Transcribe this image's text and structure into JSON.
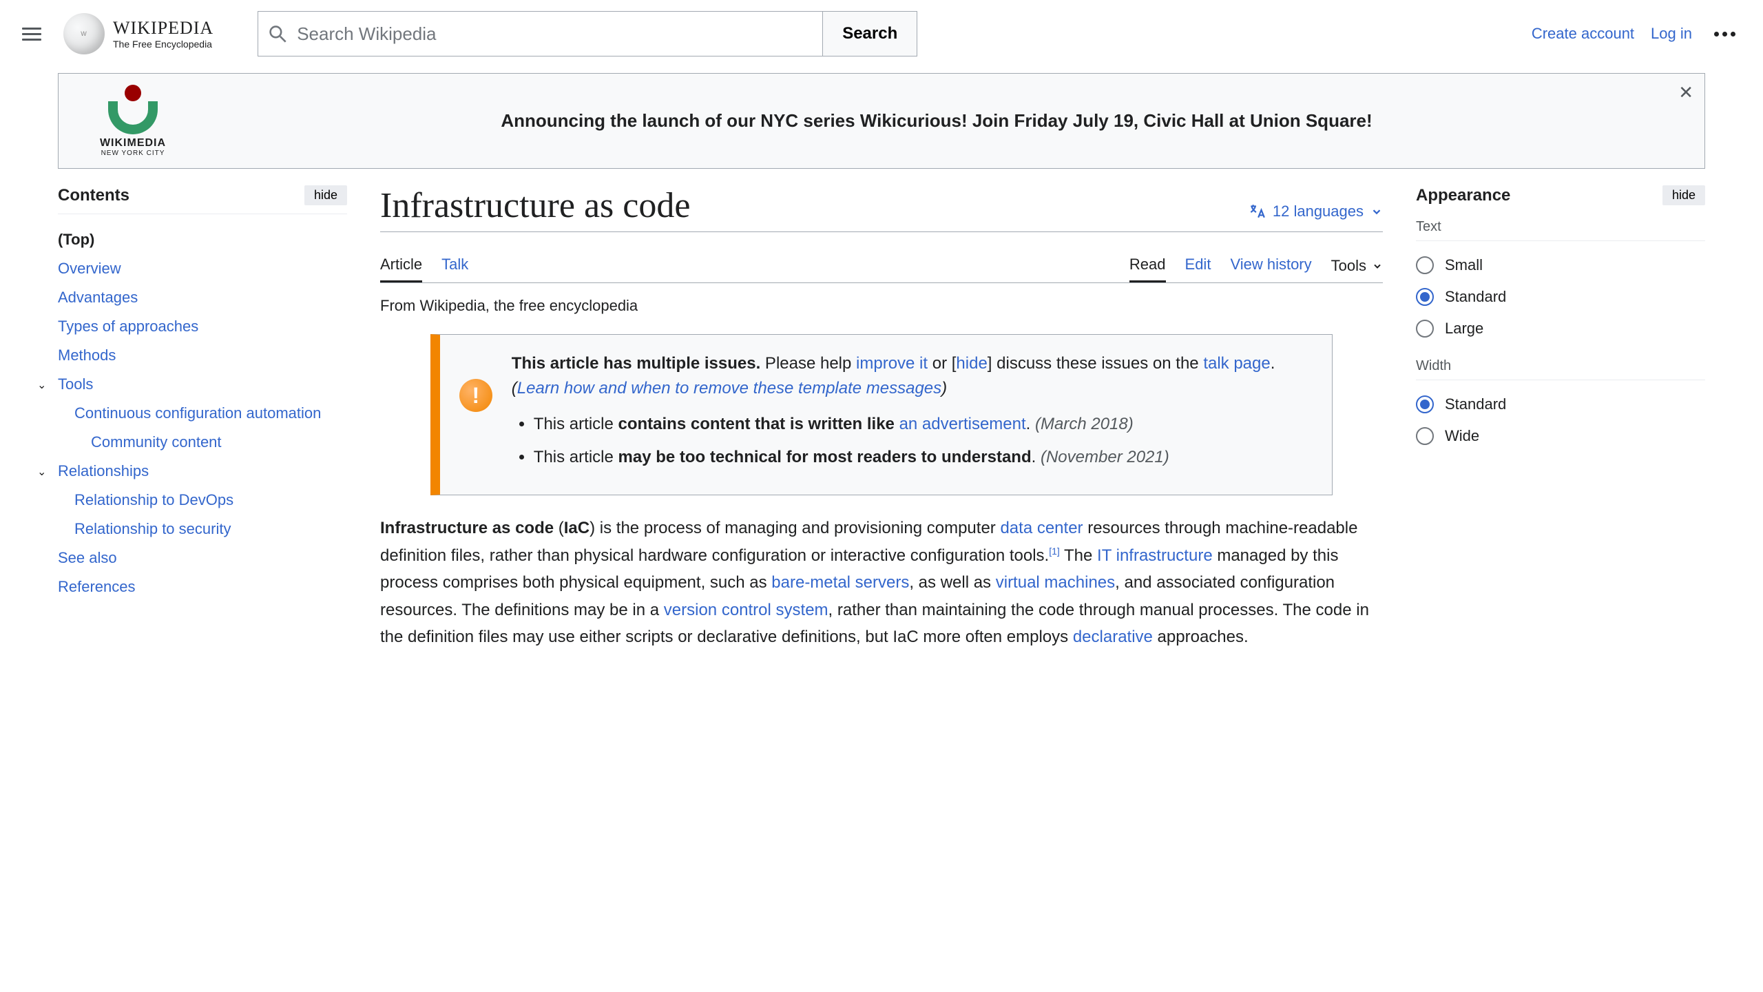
{
  "header": {
    "site_name": "WIKIPEDIA",
    "tagline": "The Free Encyclopedia",
    "search_placeholder": "Search Wikipedia",
    "search_button": "Search",
    "create_account": "Create account",
    "log_in": "Log in"
  },
  "banner": {
    "org_name": "WIKIMEDIA",
    "org_sub": "NEW YORK CITY",
    "message": "Announcing the launch of our NYC series Wikicurious! Join Friday July 19, Civic Hall at Union Square!"
  },
  "toc": {
    "title": "Contents",
    "hide": "hide",
    "items": [
      {
        "label": "(Top)",
        "top": true
      },
      {
        "label": "Overview"
      },
      {
        "label": "Advantages"
      },
      {
        "label": "Types of approaches"
      },
      {
        "label": "Methods"
      },
      {
        "label": "Tools",
        "expand": true
      },
      {
        "label": "Continuous configuration automation",
        "sub": true
      },
      {
        "label": "Community content",
        "subsub": true
      },
      {
        "label": "Relationships",
        "expand": true
      },
      {
        "label": "Relationship to DevOps",
        "sub": true
      },
      {
        "label": "Relationship to security",
        "sub": true
      },
      {
        "label": "See also"
      },
      {
        "label": "References"
      }
    ]
  },
  "article": {
    "title": "Infrastructure as code",
    "lang_count": "12 languages",
    "tabs": {
      "article": "Article",
      "talk": "Talk",
      "read": "Read",
      "edit": "Edit",
      "history": "View history",
      "tools": "Tools"
    },
    "subtitle": "From Wikipedia, the free encyclopedia",
    "issues": {
      "lead1": "This article has multiple issues.",
      "lead2": " Please help ",
      "improve": "improve it",
      "or": " or ",
      "hide": "hide",
      "discuss": " discuss these issues on the ",
      "talk_page": "talk page",
      "learn": "Learn how and when to remove these template messages",
      "item1a": "This article ",
      "item1b": "contains content that is written like ",
      "item1c": "an advertisement",
      "item1d": "(March 2018)",
      "item2a": "This article ",
      "item2b": "may be too technical for most readers to understand",
      "item2d": "(November 2021)"
    },
    "lead": {
      "p1a": "Infrastructure as code",
      "p1b": " (",
      "p1c": "IaC",
      "p1d": ") is the process of managing and provisioning computer ",
      "link_datacenter": "data center",
      "p1e": " resources through machine-readable definition files, rather than physical hardware configuration or interactive configuration tools.",
      "ref1": "[1]",
      "p1f": " The ",
      "link_itinfra": "IT infrastructure",
      "p1g": " managed by this process comprises both physical equipment, such as ",
      "link_baremetal": "bare-metal servers",
      "p1h": ", as well as ",
      "link_vm": "virtual machines",
      "p1i": ", and associated configuration resources. The definitions may be in a ",
      "link_vcs": "version control system",
      "p1j": ", rather than maintaining the code through manual processes. The code in the definition files may use either scripts or declarative definitions, but IaC more often employs ",
      "link_declarative": "declarative",
      "p1k": " approaches."
    }
  },
  "appearance": {
    "title": "Appearance",
    "hide": "hide",
    "text_label": "Text",
    "text_options": [
      "Small",
      "Standard",
      "Large"
    ],
    "text_selected": "Standard",
    "width_label": "Width",
    "width_options": [
      "Standard",
      "Wide"
    ],
    "width_selected": "Standard"
  }
}
